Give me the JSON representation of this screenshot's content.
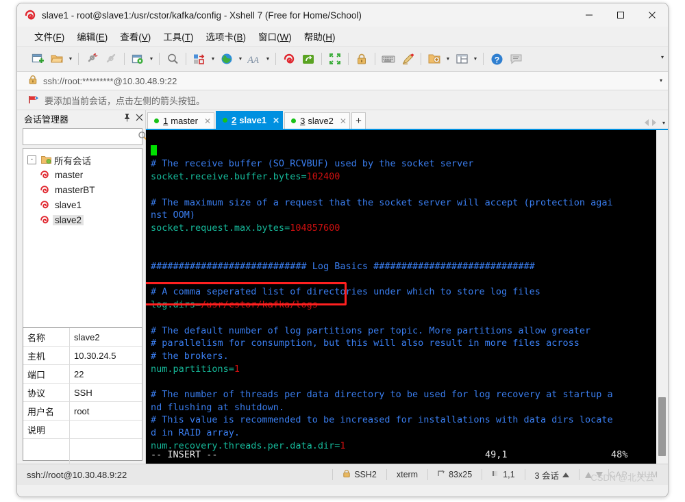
{
  "window": {
    "title": "slave1 - root@slave1:/usr/cstor/kafka/config - Xshell 7 (Free for Home/School)",
    "minimize": "—",
    "maximize": "☐",
    "close": "✕"
  },
  "menubar": [
    {
      "label": "文件",
      "key": "F"
    },
    {
      "label": "编辑",
      "key": "E"
    },
    {
      "label": "查看",
      "key": "V"
    },
    {
      "label": "工具",
      "key": "T"
    },
    {
      "label": "选项卡",
      "key": "B"
    },
    {
      "label": "窗口",
      "key": "W"
    },
    {
      "label": "帮助",
      "key": "H"
    }
  ],
  "toolbar": {
    "icons": [
      "new-session-icon",
      "open-folder-icon",
      "disconnect-icon",
      "reconnect-icon",
      "session-properties-icon",
      "find-icon",
      "transfer-file-icon",
      "globe-icon",
      "font-icon",
      "xshell-icon",
      "xftp-icon",
      "fullscreen-icon",
      "lock-icon",
      "keyboard-icon",
      "highlight-pen-icon",
      "add-to-folder-icon",
      "layout-icon",
      "help-icon",
      "comment-icon"
    ],
    "overflow": "▾"
  },
  "address": {
    "icon": "lock-icon",
    "value": "ssh://root:*********@10.30.48.9:22",
    "caret": "▾"
  },
  "notice": {
    "icon": "red-arrow-icon",
    "text": "要添加当前会话，点击左侧的箭头按钮。"
  },
  "session_manager": {
    "title": "会话管理器",
    "pin": "⚐",
    "close": "✕",
    "search_value": "",
    "search_placeholder": "",
    "search_icon": "search-icon",
    "tree": {
      "root_label": "所有会话",
      "root_toggle": "-",
      "items": [
        {
          "label": "master",
          "selected": false
        },
        {
          "label": "masterBT",
          "selected": false
        },
        {
          "label": "slave1",
          "selected": false
        },
        {
          "label": "slave2",
          "selected": true
        }
      ]
    },
    "properties": [
      {
        "key": "名称",
        "value": "slave2"
      },
      {
        "key": "主机",
        "value": "10.30.24.5"
      },
      {
        "key": "端口",
        "value": "22"
      },
      {
        "key": "协议",
        "value": "SSH"
      },
      {
        "key": "用户名",
        "value": "root"
      },
      {
        "key": "说明",
        "value": ""
      }
    ]
  },
  "tabs": {
    "items": [
      {
        "num": "1",
        "label": "master",
        "active": false,
        "close": "✕"
      },
      {
        "num": "2",
        "label": "slave1",
        "active": true,
        "close": "✕"
      },
      {
        "num": "3",
        "label": "slave2",
        "active": false,
        "close": "✕"
      }
    ],
    "add_label": "+",
    "nav_left": "prev-tab-icon",
    "nav_right": "next-tab-icon",
    "nav_caret": "▾"
  },
  "terminal": {
    "lines": [
      [
        {
          "t": "cursor"
        }
      ],
      [
        {
          "t": "comment",
          "s": "# The receive buffer (SO_RCVBUF) used by the socket server"
        }
      ],
      [
        {
          "t": "key",
          "s": "socket.receive.buffer.bytes="
        },
        {
          "t": "val",
          "s": "102400"
        }
      ],
      [
        {
          "t": "blank"
        }
      ],
      [
        {
          "t": "comment",
          "s": "# The maximum size of a request that the socket server will accept (protection agai"
        }
      ],
      [
        {
          "t": "comment",
          "s": "nst OOM)"
        }
      ],
      [
        {
          "t": "key",
          "s": "socket.request.max.bytes="
        },
        {
          "t": "val",
          "s": "104857600"
        }
      ],
      [
        {
          "t": "blank"
        }
      ],
      [
        {
          "t": "blank"
        }
      ],
      [
        {
          "t": "comment",
          "s": "############################ Log Basics #############################"
        }
      ],
      [
        {
          "t": "blank"
        }
      ],
      [
        {
          "t": "comment",
          "s": "# A comma seperated list of directories under which to store log files"
        }
      ],
      [
        {
          "t": "key",
          "s": "log.dirs="
        },
        {
          "t": "val",
          "s": "/usr/cstor/kafka/logs"
        }
      ],
      [
        {
          "t": "blank"
        }
      ],
      [
        {
          "t": "comment",
          "s": "# The default number of log partitions per topic. More partitions allow greater"
        }
      ],
      [
        {
          "t": "comment",
          "s": "# parallelism for consumption, but this will also result in more files across"
        }
      ],
      [
        {
          "t": "comment",
          "s": "# the brokers."
        }
      ],
      [
        {
          "t": "key",
          "s": "num.partitions="
        },
        {
          "t": "val",
          "s": "1"
        }
      ],
      [
        {
          "t": "blank"
        }
      ],
      [
        {
          "t": "comment",
          "s": "# The number of threads per data directory to be used for log recovery at startup a"
        }
      ],
      [
        {
          "t": "comment",
          "s": "nd flushing at shutdown."
        }
      ],
      [
        {
          "t": "comment",
          "s": "# This value is recommended to be increased for installations with data dirs locate"
        }
      ],
      [
        {
          "t": "comment",
          "s": "d in RAID array."
        }
      ],
      [
        {
          "t": "key",
          "s": "num.recovery.threads.per.data.dir="
        },
        {
          "t": "val",
          "s": "1"
        }
      ]
    ],
    "status": {
      "mode": "-- INSERT --",
      "position": "49,1",
      "percent": "48%"
    },
    "highlight_color": "#ff2020"
  },
  "statusbar": {
    "connection": "ssh://root@10.30.48.9:22",
    "lock_icon": "lock-icon",
    "protocol": "SSH2",
    "term_type": "xterm",
    "size_icon": "terminal-size-icon",
    "size": "83x25",
    "cursor_icon": "cursor-position-icon",
    "cursor": "1,1",
    "sessions": "3 会话",
    "sessions_caret": "▲",
    "arrow_up": "scroll-up-icon",
    "arrow_down": "scroll-down-icon",
    "caps": "CAP",
    "num": "NUM",
    "watermark": "CSDN @北天云"
  },
  "colors": {
    "accent": "#0090e0",
    "terminal_bg": "#000000",
    "comment": "#3a7ef0",
    "key": "#16b99a",
    "value": "#d01010",
    "cursor": "#00e000",
    "highlight": "#ff2020"
  }
}
